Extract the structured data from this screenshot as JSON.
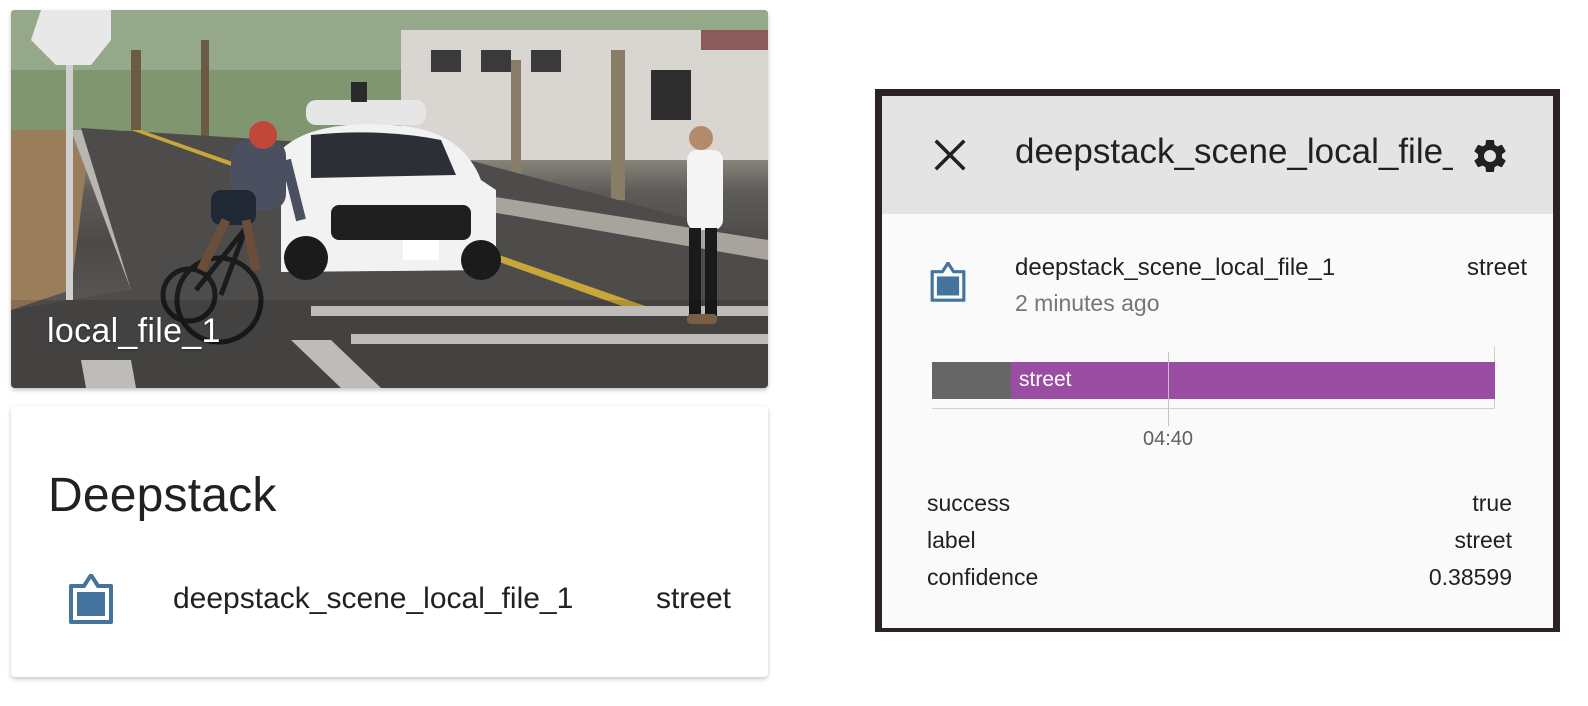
{
  "camera_card": {
    "title": "local_file_1"
  },
  "entities_card": {
    "title": "Deepstack",
    "rows": [
      {
        "name": "deepstack_scene_local_file_1",
        "state": "street",
        "icon": "clipboard-icon"
      }
    ]
  },
  "more_info_dialog": {
    "title": "deepstack_scene_local_file_1",
    "close_icon": "close-icon",
    "settings_icon": "gear-icon",
    "state_card": {
      "name": "deepstack_scene_local_file_1",
      "relative_time": "2 minutes ago",
      "state": "street",
      "icon": "clipboard-icon"
    },
    "history": {
      "segments": [
        {
          "state": "",
          "start_fraction": 0.0,
          "end_fraction": 0.14,
          "color": "#666666"
        },
        {
          "state": "street",
          "start_fraction": 0.14,
          "end_fraction": 1.0,
          "color": "#9a4ea3"
        }
      ],
      "ticks": [
        {
          "label": "04:40",
          "fraction": 0.419
        }
      ]
    },
    "attributes": [
      {
        "key": "success",
        "value": "true"
      },
      {
        "key": "label",
        "value": "street"
      },
      {
        "key": "confidence",
        "value": "0.38599"
      }
    ]
  },
  "colors": {
    "icon": "#44739e",
    "state_bar": "#9a4ea3",
    "unknown_bar": "#666666",
    "dialog_header": "#e4e4e4"
  }
}
